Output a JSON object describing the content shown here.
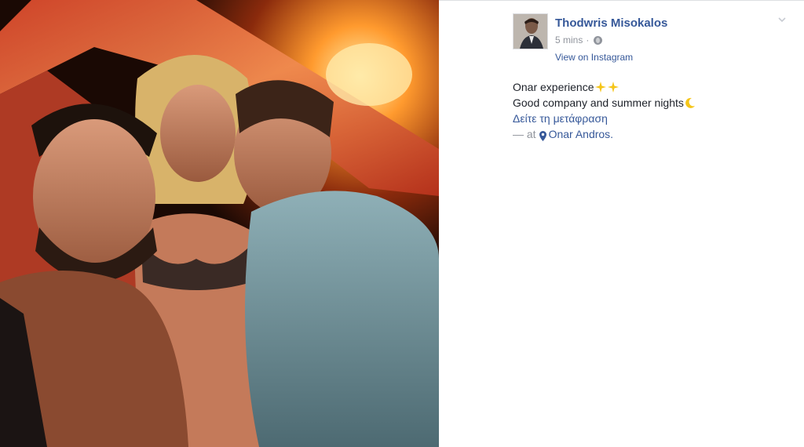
{
  "post": {
    "author_name": "Thodwris Misokalos",
    "time": "5 mins",
    "separator": "·",
    "via_link": "View on Instagram",
    "text_line1": "Onar experience",
    "text_line2": "Good company and summer nights",
    "translate_link": "Δείτε τη μετάφραση",
    "at_prefix": "— at",
    "place": "Onar Andros."
  },
  "icons": {
    "privacy": "globe-icon",
    "options": "chevron-down-icon",
    "sparkles": "sparkles-icon",
    "moon": "crescent-moon-icon",
    "location": "map-pin-icon"
  },
  "colors": {
    "link": "#365899",
    "text": "#1d2129",
    "muted": "#90949c"
  }
}
